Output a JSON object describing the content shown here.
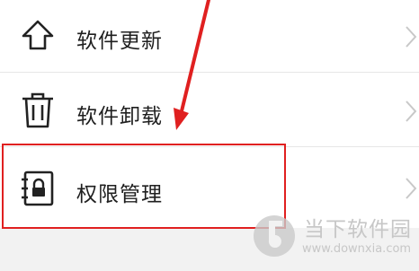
{
  "menu": {
    "items": [
      {
        "label": "软件更新",
        "icon": "upload-arrow-icon"
      },
      {
        "label": "软件卸载",
        "icon": "trash-icon"
      },
      {
        "label": "权限管理",
        "icon": "lock-book-icon"
      }
    ]
  },
  "annotation": {
    "color": "#e02020"
  },
  "watermark": {
    "title": "当下软件园",
    "url": "www.downxia.com"
  }
}
